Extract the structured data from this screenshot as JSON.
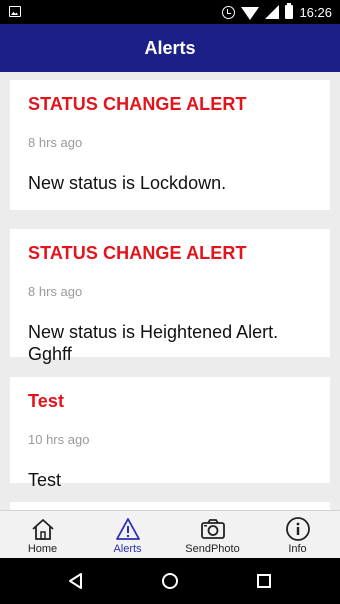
{
  "status_bar": {
    "time": "16:26"
  },
  "header": {
    "title": "Alerts"
  },
  "alerts": [
    {
      "title": "STATUS CHANGE ALERT",
      "time": "8 hrs ago",
      "message": "New status is Lockdown."
    },
    {
      "title": "STATUS CHANGE ALERT",
      "time": "8 hrs ago",
      "message": "New status is Heightened Alert. Gghff"
    },
    {
      "title": "Test",
      "time": "10 hrs ago",
      "message": "Test"
    }
  ],
  "nav": {
    "items": [
      {
        "label": "Home",
        "icon": "home-icon"
      },
      {
        "label": "Alerts",
        "icon": "alert-triangle-icon"
      },
      {
        "label": "SendPhoto",
        "icon": "camera-icon"
      },
      {
        "label": "Info",
        "icon": "info-icon"
      }
    ],
    "active": "Alerts"
  },
  "colors": {
    "app_bar": "#1c1f85",
    "alert_title": "#e3141b",
    "active_nav": "#2a2fb3"
  }
}
